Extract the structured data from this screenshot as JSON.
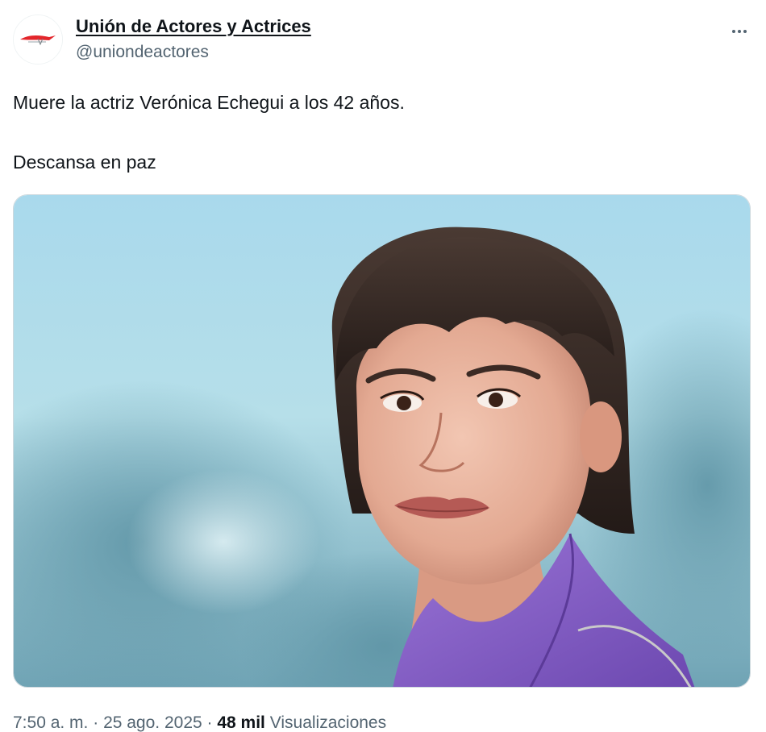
{
  "author": {
    "display_name": "Unión de Actores y Actrices",
    "handle": "@uniondeactores"
  },
  "tweet": {
    "line1": "Muere la actriz Verónica Echegui a los 42 años.",
    "line2": "Descansa en paz"
  },
  "meta": {
    "time": "7:50 a. m.",
    "sep1": " · ",
    "date": "25 ago. 2025",
    "sep2": " · ",
    "views_count": "48 mil",
    "views_label": " Visualizaciones"
  },
  "icons": {
    "avatar": "union-logo-icon",
    "more": "more-options-icon"
  },
  "colors": {
    "text_primary": "#0f1419",
    "text_secondary": "#536471",
    "border": "#cfd9de",
    "logo_red": "#e3262b"
  }
}
